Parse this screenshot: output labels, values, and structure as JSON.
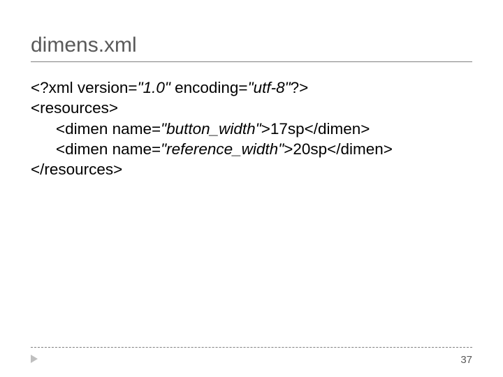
{
  "title": "dimens.xml",
  "code": {
    "line1_a": "<?xml version=",
    "line1_b": "\"1.0\"",
    "line1_c": " encoding=",
    "line1_d": "\"utf-8\"",
    "line1_e": "?>",
    "line2": "<resources>",
    "line3_a": "<dimen name=",
    "line3_b": "\"button_width\"",
    "line3_c": ">17sp</dimen>",
    "line4_a": "<dimen name=",
    "line4_b": "\"reference_width\"",
    "line4_c": ">20sp</dimen>",
    "line5": "</resources>"
  },
  "page_number": "37"
}
